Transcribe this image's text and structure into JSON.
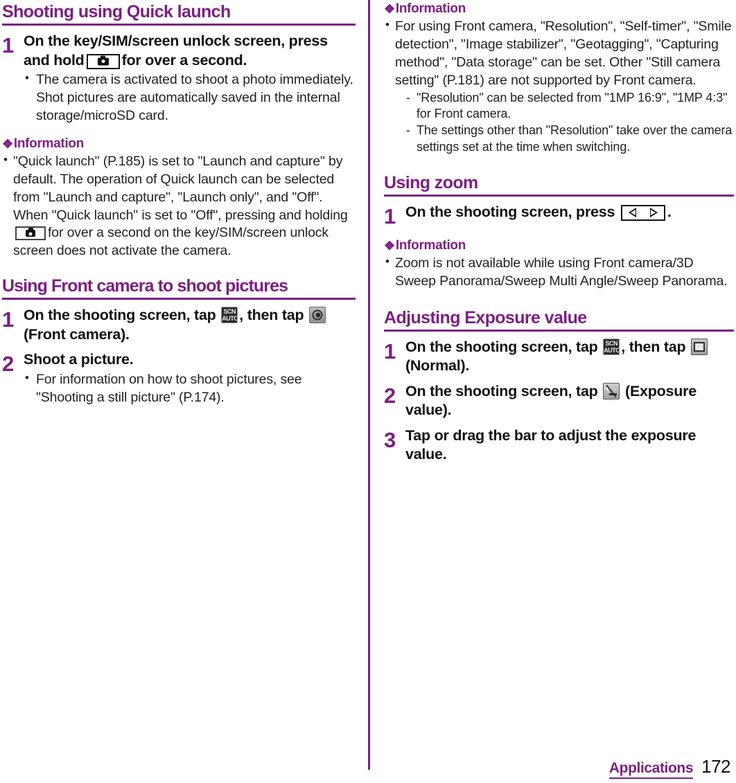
{
  "page": {
    "number": "172",
    "chapter": "Applications",
    "accent_color": "#7b2082",
    "text_color": "#1a1a1a"
  },
  "left_column": {
    "heading_1": "Shooting using Quick launch",
    "step_1": {
      "number": "1",
      "title_part_1": "On the key/SIM/screen unlock screen, press and hold",
      "title_icon": "camera-key-icon",
      "title_part_2": "for over a second.",
      "bullets": [
        "The camera is activated to shoot a photo immediately. Shot pictures are automatically saved in the internal storage/microSD card."
      ]
    },
    "information_1": {
      "label": "Information",
      "diamond": "❖",
      "bullet_part_1": "\"Quick launch\" (P.185) is set to \"Launch and capture\" by default. The operation of Quick launch can be selected from \"Launch and capture\", \"Launch only\", and \"Off\". When \"Quick launch\" is set to \"Off\", pressing and holding",
      "bullet_icon": "camera-key-icon",
      "bullet_part_2": "for over a second on the key/SIM/screen unlock screen does not activate the camera."
    },
    "heading_2": "Using Front camera to shoot pictures",
    "step_2": {
      "number": "1",
      "title_part_1": "On the shooting screen, tap",
      "title_icon_1": "scn-auto-icon",
      "title_part_2": ", then tap",
      "title_icon_2": "front-camera-icon",
      "title_part_3": "(Front camera)."
    },
    "step_3": {
      "number": "2",
      "title": "Shoot a picture.",
      "bullets": [
        "For information on how to shoot pictures, see \"Shooting a still picture\" (P.174)."
      ]
    }
  },
  "right_column": {
    "information_1": {
      "label": "Information",
      "diamond": "❖",
      "bullet": "For using Front camera, \"Resolution\", \"Self-timer\", \"Smile detection\", \"Image stabilizer\", \"Geotagging\", \"Capturing method\", \"Data storage\" can be set. Other \"Still camera setting\" (P.181) are not supported by Front camera.",
      "sub_bullets": [
        "\"Resolution\" can be selected from \"1MP 16:9\", \"1MP 4:3\" for Front camera.",
        "The settings other than \"Resolution\" take over the camera settings set at the time when switching."
      ]
    },
    "heading_1": "Using zoom",
    "step_1": {
      "number": "1",
      "title_part_1": "On the shooting screen, press",
      "title_icon": "zoom-key-icon",
      "title_part_2": "."
    },
    "information_2": {
      "label": "Information",
      "diamond": "❖",
      "bullet": "Zoom is not available while using Front camera/3D Sweep Panorama/Sweep Multi Angle/Sweep Panorama."
    },
    "heading_2": "Adjusting Exposure value",
    "step_2": {
      "number": "1",
      "title_part_1": "On the shooting screen, tap",
      "title_icon_1": "scn-auto-icon",
      "title_part_2": ", then tap",
      "title_icon_2": "normal-mode-icon",
      "title_part_3": "(Normal)."
    },
    "step_3": {
      "number": "2",
      "title_part_1": "On the shooting screen, tap",
      "title_icon": "exposure-value-icon",
      "title_part_2": "(Exposure value)."
    },
    "step_4": {
      "number": "3",
      "title": "Tap or drag the bar to adjust the exposure value."
    }
  },
  "icons": {
    "scn_auto_line1": "SCN",
    "scn_auto_line2": "AUTO"
  }
}
